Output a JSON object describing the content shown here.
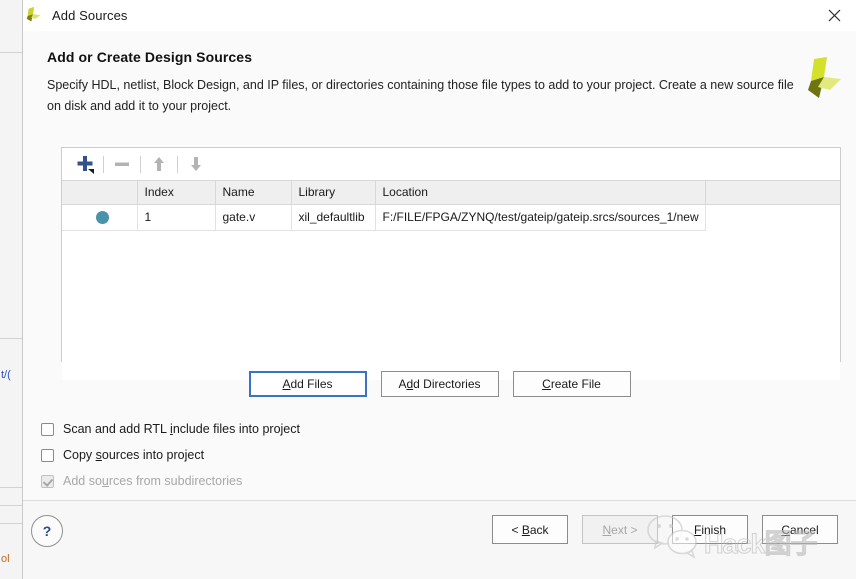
{
  "window": {
    "title": "Add Sources",
    "logo_icon": "vivado-logo-icon",
    "close_icon": "close-icon"
  },
  "content": {
    "heading": "Add or Create Design Sources",
    "description": "Specify HDL, netlist, Block Design, and IP files, or directories containing those file types to add to your project. Create a new source file on disk and add it to your project.",
    "brand_icon": "xilinx-vivado-logo-icon"
  },
  "toolbar": {
    "add_icon": "plus-icon",
    "add_dropdown_icon": "dropdown-triangle-icon",
    "remove_icon": "minus-icon",
    "move_up_icon": "arrow-up-icon",
    "move_down_icon": "arrow-down-icon"
  },
  "table": {
    "columns": [
      "",
      "Index",
      "Name",
      "Library",
      "Location",
      ""
    ],
    "rows": [
      {
        "status_icon": "source-dot-icon",
        "index": "1",
        "name": "gate.v",
        "library": "xil_defaultlib",
        "location": "F:/FILE/FPGA/ZYNQ/test/gateip/gateip.srcs/sources_1/new"
      }
    ]
  },
  "actions": {
    "add_files": {
      "pre": "A",
      "mnemonic": "",
      "post": "dd Files",
      "full": "Add Files"
    },
    "add_directories": {
      "pre": "A",
      "mnemonic": "d",
      "post": "d Directories",
      "full": "Add Directories"
    },
    "create_file": {
      "pre": "",
      "mnemonic": "C",
      "post": "reate File",
      "full": "Create File"
    }
  },
  "options": [
    {
      "label_pre": "Scan and add RTL ",
      "mnemonic": "i",
      "label_post": "nclude files into project",
      "checked": false,
      "enabled": true
    },
    {
      "label_pre": "Copy ",
      "mnemonic": "s",
      "label_post": "ources into project",
      "checked": false,
      "enabled": true
    },
    {
      "label_pre": "Add so",
      "mnemonic": "u",
      "label_post": "rces from subdirectories",
      "checked": true,
      "enabled": false
    }
  ],
  "footer": {
    "help_label": "?",
    "back": {
      "pre": "< ",
      "mnemonic": "B",
      "post": "ack",
      "full": "< Back"
    },
    "next": {
      "pre": "",
      "mnemonic": "N",
      "post": "ext >",
      "full": "Next >"
    },
    "finish": {
      "pre": "",
      "mnemonic": "F",
      "post": "inish",
      "full": "Finish"
    },
    "cancel": {
      "pre": "",
      "mnemonic": "C",
      "post": "ancel",
      "full": "Cancel"
    }
  },
  "watermark": {
    "text": "Hack图子",
    "logo_icon": "wechat-logo-icon"
  },
  "background": {
    "fragment_blue": "t/(",
    "fragment_orange": "ol"
  },
  "colors": {
    "accent_blue": "#3b73c4",
    "row_dot": "#4a93ab",
    "brand_green": "#c3d225",
    "brand_olive": "#6e7410",
    "help_blue": "#2a4a8c"
  }
}
